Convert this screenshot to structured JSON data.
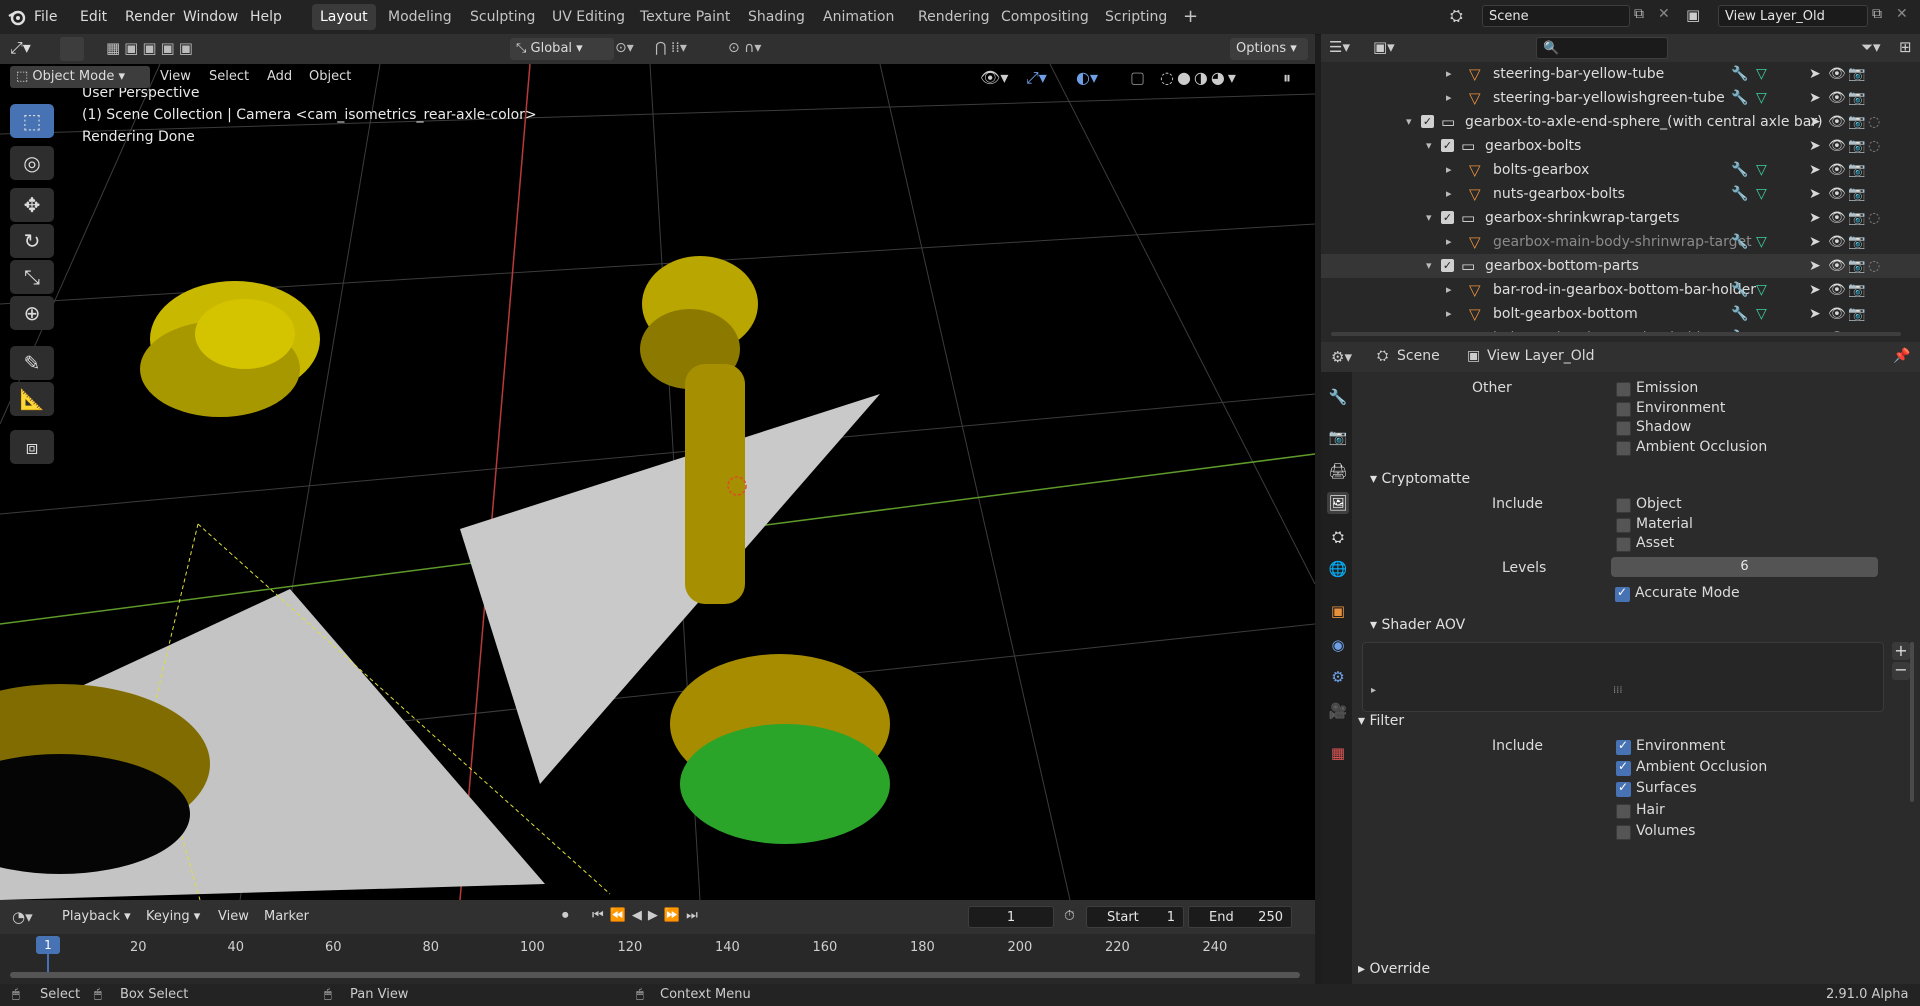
{
  "topbar": {
    "menus": [
      "File",
      "Edit",
      "Render",
      "Window",
      "Help"
    ],
    "workspaces": [
      "Layout",
      "Modeling",
      "Sculpting",
      "UV Editing",
      "Texture Paint",
      "Shading",
      "Animation",
      "Rendering",
      "Compositing",
      "Scripting"
    ],
    "active_workspace": "Layout",
    "add_tab": "+",
    "scene": "Scene",
    "view_layer": "View Layer_Old"
  },
  "viewport_header": {
    "orientation": "Global",
    "options": "Options",
    "mode": "Object Mode",
    "menus": [
      "View",
      "Select",
      "Add",
      "Object"
    ]
  },
  "viewport": {
    "perspective": "User Perspective",
    "collection_info": "(1) Scene Collection | Camera <cam_isometrics_rear-axle-color>",
    "status": "Rendering Done"
  },
  "outliner": {
    "rows": [
      {
        "label": "steering-bar-yellow-tube",
        "icon": "mesh",
        "dim": false
      },
      {
        "label": "steering-bar-yellowishgreen-tube",
        "icon": "mesh",
        "dim": false
      },
      {
        "label": "gearbox-to-axle-end-sphere_(with central axle bar)",
        "icon": "collection",
        "dim": false
      },
      {
        "label": "gearbox-bolts",
        "icon": "collection",
        "dim": false
      },
      {
        "label": "bolts-gearbox",
        "icon": "mesh",
        "dim": false
      },
      {
        "label": "nuts-gearbox-bolts",
        "icon": "mesh",
        "dim": false
      },
      {
        "label": "gearbox-shrinkwrap-targets",
        "icon": "collection",
        "dim": false
      },
      {
        "label": "gearbox-main-body-shrinwrap-target",
        "icon": "mesh",
        "dim": true
      },
      {
        "label": "gearbox-bottom-parts",
        "icon": "collection",
        "dim": false
      },
      {
        "label": "bar-rod-in-gearbox-bottom-bar-holder",
        "icon": "mesh",
        "dim": false
      },
      {
        "label": "bolt-gearbox-bottom",
        "icon": "mesh",
        "dim": false
      },
      {
        "label": "bolt-gearbox-bottom-bar-holder",
        "icon": "mesh",
        "dim": true
      }
    ]
  },
  "properties": {
    "header_scene": "Scene",
    "header_view_layer": "View Layer_Old",
    "other_label": "Other",
    "other_items": [
      {
        "label": "Emission",
        "checked": false
      },
      {
        "label": "Environment",
        "checked": false
      },
      {
        "label": "Shadow",
        "checked": false
      },
      {
        "label": "Ambient Occlusion",
        "checked": false
      }
    ],
    "cryptomatte_title": "Cryptomatte",
    "include_label": "Include",
    "crypto_items": [
      {
        "label": "Object",
        "checked": false
      },
      {
        "label": "Material",
        "checked": false
      },
      {
        "label": "Asset",
        "checked": false
      }
    ],
    "levels_label": "Levels",
    "levels_value": "6",
    "accurate_mode": "Accurate Mode",
    "shader_aov_title": "Shader AOV",
    "filter_title": "Filter",
    "filter_items": [
      {
        "label": "Environment",
        "checked": true
      },
      {
        "label": "Ambient Occlusion",
        "checked": true
      },
      {
        "label": "Surfaces",
        "checked": true
      },
      {
        "label": "Hair",
        "checked": false
      },
      {
        "label": "Volumes",
        "checked": false
      }
    ],
    "override_title": "Override"
  },
  "timeline": {
    "menus": [
      "Playback",
      "Keying",
      "View",
      "Marker"
    ],
    "current_frame": "1",
    "start_label": "Start",
    "start": "1",
    "end_label": "End",
    "end": "250",
    "ticks": [
      "20",
      "40",
      "60",
      "80",
      "100",
      "120",
      "140",
      "160",
      "180",
      "200",
      "220",
      "240"
    ],
    "marker_frame": "1"
  },
  "statusbar": {
    "select": "Select",
    "box_select": "Box Select",
    "pan_view": "Pan View",
    "context_menu": "Context Menu",
    "version": "2.91.0 Alpha"
  },
  "colors": {
    "accent": "#4772b3",
    "mesh_icon": "#e8903c",
    "modifier_icon": "#6fa0e6",
    "data_icon": "#3cd1a0"
  }
}
